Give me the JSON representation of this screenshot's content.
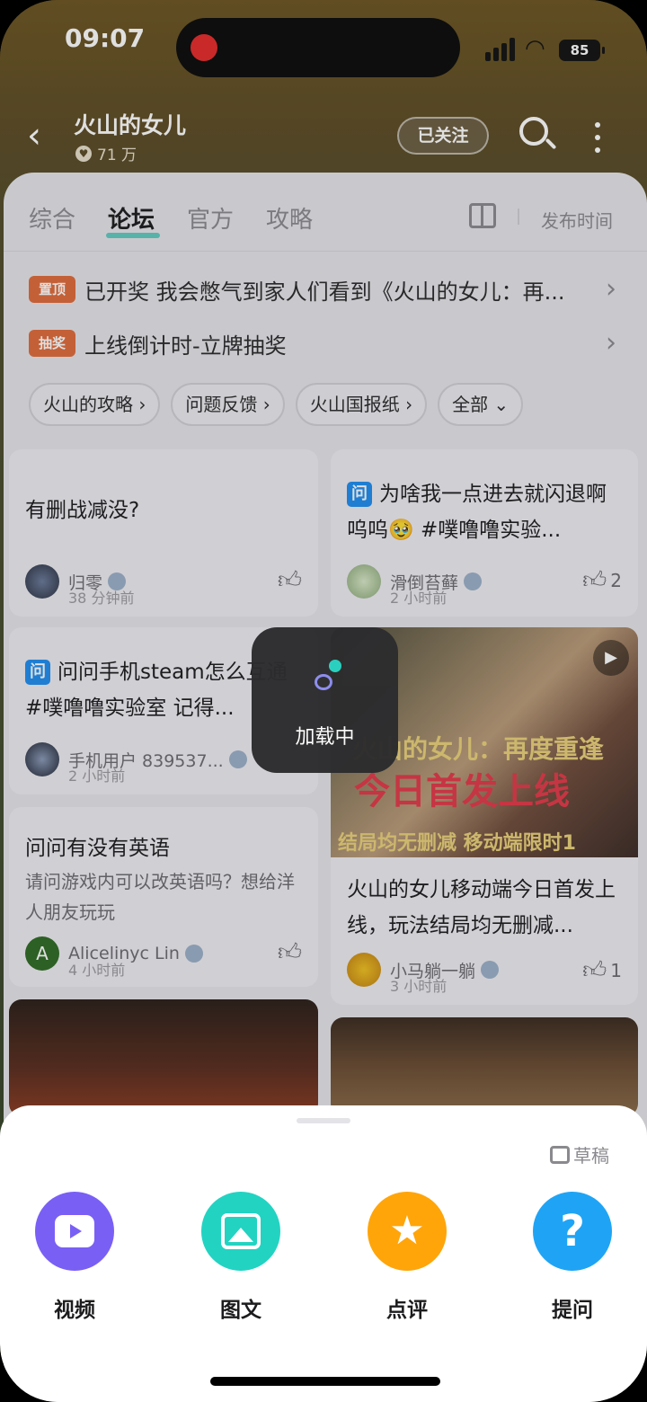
{
  "status": {
    "time": "09:07",
    "battery": "85"
  },
  "header": {
    "title": "火山的女儿",
    "followers": "71 万",
    "follow_label": "已关注"
  },
  "tabs": [
    "综合",
    "论坛",
    "官方",
    "攻略"
  ],
  "active_tab": "论坛",
  "sort_label": "发布时间",
  "pinned": [
    {
      "tag": "置顶",
      "text": "已开奖 我会憋气到家人们看到《火山的女儿：再..."
    },
    {
      "tag": "抽奖",
      "text": "上线倒计时-立牌抽奖"
    }
  ],
  "chips": [
    "火山的攻略 ›",
    "问题反馈 ›",
    "火山国报纸 ›",
    "全部 ⌄"
  ],
  "posts": [
    {
      "title": "有删战减没?",
      "author": "归零",
      "time": "38 分钟前",
      "likes": ""
    },
    {
      "tag": "问",
      "title": "为啥我一点进去就闪退啊呜呜🥹 #噗噜噜实验...",
      "author": "滑倒苔藓",
      "time": "2 小时前",
      "likes": "2"
    },
    {
      "tag": "问",
      "title": "问问手机steam怎么互通 #噗噜噜实验室 记得...",
      "author": "手机用户 839537...",
      "time": "2 小时前",
      "likes": ""
    },
    {
      "title": "问问有没有英语",
      "desc": "请问游戏内可以改英语吗？想给洋人朋友玩玩",
      "author": "Alicelinyc Lin",
      "avatar_letter": "A",
      "time": "4 小时前",
      "likes": ""
    },
    {
      "title": "火山的女儿移动端今日首发上线，玩法结局均无删减...",
      "author": "小马躺一躺",
      "time": "3 小时前",
      "likes": "1",
      "video_title": "火山的女儿：再度重逢",
      "video_banner": "今日首发上线",
      "video_sub": "结局均无删减 移动端限时1"
    }
  ],
  "loading_text": "加载中",
  "sheet": {
    "draft_label": "草稿",
    "actions": [
      {
        "label": "视频",
        "icon": "video-icon",
        "color": "#7a5ff5"
      },
      {
        "label": "图文",
        "icon": "image-icon",
        "color": "#22d3c2"
      },
      {
        "label": "点评",
        "icon": "star-icon",
        "color": "#ffa50a"
      },
      {
        "label": "提问",
        "icon": "question-icon",
        "color": "#1fa4f5"
      }
    ]
  }
}
